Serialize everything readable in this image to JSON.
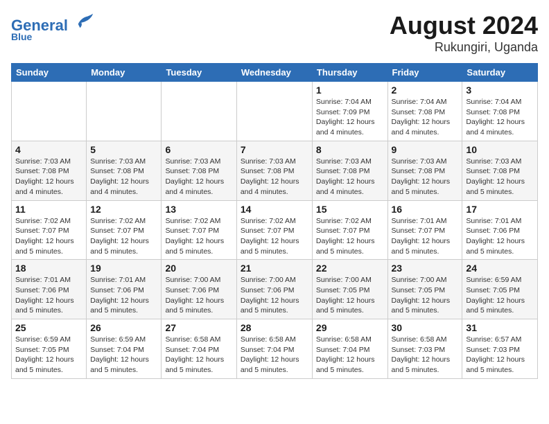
{
  "header": {
    "logo_line1": "General",
    "logo_line2": "Blue",
    "month_year": "August 2024",
    "location": "Rukungiri, Uganda"
  },
  "days_of_week": [
    "Sunday",
    "Monday",
    "Tuesday",
    "Wednesday",
    "Thursday",
    "Friday",
    "Saturday"
  ],
  "weeks": [
    [
      {
        "num": "",
        "info": ""
      },
      {
        "num": "",
        "info": ""
      },
      {
        "num": "",
        "info": ""
      },
      {
        "num": "",
        "info": ""
      },
      {
        "num": "1",
        "info": "Sunrise: 7:04 AM\nSunset: 7:09 PM\nDaylight: 12 hours\nand 4 minutes."
      },
      {
        "num": "2",
        "info": "Sunrise: 7:04 AM\nSunset: 7:08 PM\nDaylight: 12 hours\nand 4 minutes."
      },
      {
        "num": "3",
        "info": "Sunrise: 7:04 AM\nSunset: 7:08 PM\nDaylight: 12 hours\nand 4 minutes."
      }
    ],
    [
      {
        "num": "4",
        "info": "Sunrise: 7:03 AM\nSunset: 7:08 PM\nDaylight: 12 hours\nand 4 minutes."
      },
      {
        "num": "5",
        "info": "Sunrise: 7:03 AM\nSunset: 7:08 PM\nDaylight: 12 hours\nand 4 minutes."
      },
      {
        "num": "6",
        "info": "Sunrise: 7:03 AM\nSunset: 7:08 PM\nDaylight: 12 hours\nand 4 minutes."
      },
      {
        "num": "7",
        "info": "Sunrise: 7:03 AM\nSunset: 7:08 PM\nDaylight: 12 hours\nand 4 minutes."
      },
      {
        "num": "8",
        "info": "Sunrise: 7:03 AM\nSunset: 7:08 PM\nDaylight: 12 hours\nand 4 minutes."
      },
      {
        "num": "9",
        "info": "Sunrise: 7:03 AM\nSunset: 7:08 PM\nDaylight: 12 hours\nand 5 minutes."
      },
      {
        "num": "10",
        "info": "Sunrise: 7:03 AM\nSunset: 7:08 PM\nDaylight: 12 hours\nand 5 minutes."
      }
    ],
    [
      {
        "num": "11",
        "info": "Sunrise: 7:02 AM\nSunset: 7:07 PM\nDaylight: 12 hours\nand 5 minutes."
      },
      {
        "num": "12",
        "info": "Sunrise: 7:02 AM\nSunset: 7:07 PM\nDaylight: 12 hours\nand 5 minutes."
      },
      {
        "num": "13",
        "info": "Sunrise: 7:02 AM\nSunset: 7:07 PM\nDaylight: 12 hours\nand 5 minutes."
      },
      {
        "num": "14",
        "info": "Sunrise: 7:02 AM\nSunset: 7:07 PM\nDaylight: 12 hours\nand 5 minutes."
      },
      {
        "num": "15",
        "info": "Sunrise: 7:02 AM\nSunset: 7:07 PM\nDaylight: 12 hours\nand 5 minutes."
      },
      {
        "num": "16",
        "info": "Sunrise: 7:01 AM\nSunset: 7:07 PM\nDaylight: 12 hours\nand 5 minutes."
      },
      {
        "num": "17",
        "info": "Sunrise: 7:01 AM\nSunset: 7:06 PM\nDaylight: 12 hours\nand 5 minutes."
      }
    ],
    [
      {
        "num": "18",
        "info": "Sunrise: 7:01 AM\nSunset: 7:06 PM\nDaylight: 12 hours\nand 5 minutes."
      },
      {
        "num": "19",
        "info": "Sunrise: 7:01 AM\nSunset: 7:06 PM\nDaylight: 12 hours\nand 5 minutes."
      },
      {
        "num": "20",
        "info": "Sunrise: 7:00 AM\nSunset: 7:06 PM\nDaylight: 12 hours\nand 5 minutes."
      },
      {
        "num": "21",
        "info": "Sunrise: 7:00 AM\nSunset: 7:06 PM\nDaylight: 12 hours\nand 5 minutes."
      },
      {
        "num": "22",
        "info": "Sunrise: 7:00 AM\nSunset: 7:05 PM\nDaylight: 12 hours\nand 5 minutes."
      },
      {
        "num": "23",
        "info": "Sunrise: 7:00 AM\nSunset: 7:05 PM\nDaylight: 12 hours\nand 5 minutes."
      },
      {
        "num": "24",
        "info": "Sunrise: 6:59 AM\nSunset: 7:05 PM\nDaylight: 12 hours\nand 5 minutes."
      }
    ],
    [
      {
        "num": "25",
        "info": "Sunrise: 6:59 AM\nSunset: 7:05 PM\nDaylight: 12 hours\nand 5 minutes."
      },
      {
        "num": "26",
        "info": "Sunrise: 6:59 AM\nSunset: 7:04 PM\nDaylight: 12 hours\nand 5 minutes."
      },
      {
        "num": "27",
        "info": "Sunrise: 6:58 AM\nSunset: 7:04 PM\nDaylight: 12 hours\nand 5 minutes."
      },
      {
        "num": "28",
        "info": "Sunrise: 6:58 AM\nSunset: 7:04 PM\nDaylight: 12 hours\nand 5 minutes."
      },
      {
        "num": "29",
        "info": "Sunrise: 6:58 AM\nSunset: 7:04 PM\nDaylight: 12 hours\nand 5 minutes."
      },
      {
        "num": "30",
        "info": "Sunrise: 6:58 AM\nSunset: 7:03 PM\nDaylight: 12 hours\nand 5 minutes."
      },
      {
        "num": "31",
        "info": "Sunrise: 6:57 AM\nSunset: 7:03 PM\nDaylight: 12 hours\nand 5 minutes."
      }
    ]
  ]
}
